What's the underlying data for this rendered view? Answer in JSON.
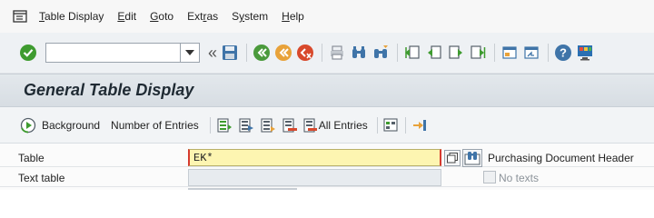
{
  "menubar": {
    "items": [
      {
        "underline": "T",
        "rest": "able Display"
      },
      {
        "underline": "E",
        "rest": "dit"
      },
      {
        "underline": "G",
        "rest": "oto"
      },
      {
        "pre": "Ext",
        "underline": "r",
        "rest": "as"
      },
      {
        "pre": "S",
        "underline": "y",
        "rest": "stem"
      },
      {
        "underline": "H",
        "rest": "elp"
      }
    ]
  },
  "toolbar": {
    "command_value": "",
    "icons": [
      "enter-icon",
      "save-icon",
      "back-icon",
      "exit-icon",
      "cancel-icon",
      "print-icon",
      "find-icon",
      "find-next-icon",
      "first-page-icon",
      "previous-page-icon",
      "next-page-icon",
      "last-page-icon",
      "create-session-icon",
      "shortcut-icon",
      "help-icon",
      "customize-layout-icon"
    ]
  },
  "title": "General Table Display",
  "app_toolbar": {
    "background_label": "Background",
    "number_of_entries_label": "Number of Entries",
    "all_entries_label": "All Entries"
  },
  "form": {
    "table_label": "Table",
    "table_value": "EK*",
    "table_description": "Purchasing Document Header",
    "text_table_label": "Text table",
    "no_texts_label": "No texts"
  },
  "colors": {
    "title_bar": "#dde3e8",
    "required_input": "#fdf5b1",
    "required_marker": "#d63a2f"
  }
}
